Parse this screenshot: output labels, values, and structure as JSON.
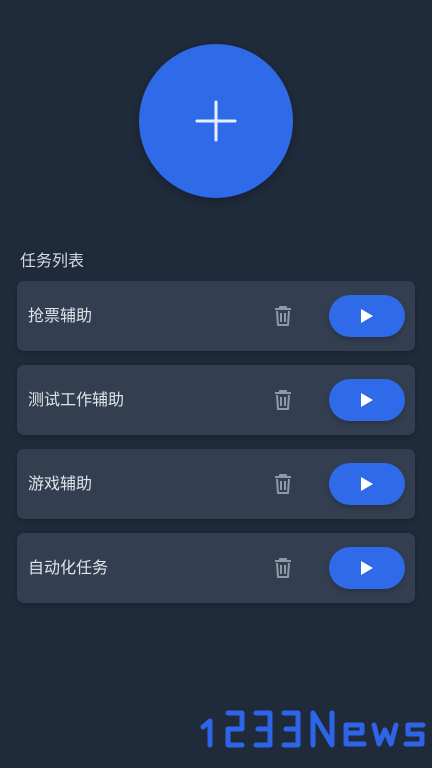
{
  "app": {
    "add_icon": "plus-icon",
    "section_title": "任务列表",
    "accent_color": "#2f6ae9"
  },
  "tasks": [
    {
      "name": "抢票辅助",
      "delete_icon": "trash-icon",
      "run_icon": "play-icon"
    },
    {
      "name": "测试工作辅助",
      "delete_icon": "trash-icon",
      "run_icon": "play-icon"
    },
    {
      "name": "游戏辅助",
      "delete_icon": "trash-icon",
      "run_icon": "play-icon"
    },
    {
      "name": "自动化任务",
      "delete_icon": "trash-icon",
      "run_icon": "play-icon"
    }
  ],
  "watermark": {
    "text": "1233News",
    "color": "#2e65e8"
  }
}
